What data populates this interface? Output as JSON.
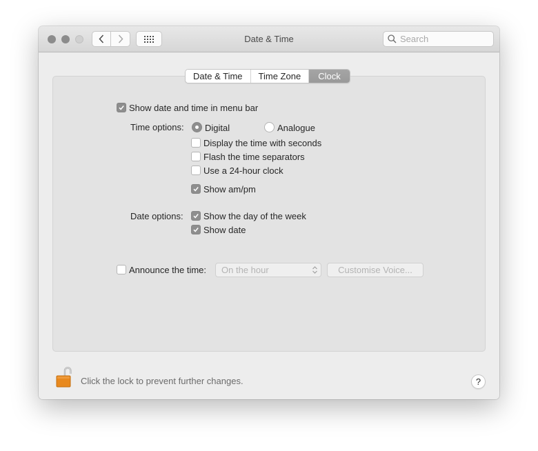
{
  "window": {
    "title": "Date & Time",
    "search_placeholder": "Search",
    "search_value": ""
  },
  "toolbar": {
    "back_icon": "chevron-left-icon",
    "forward_icon": "chevron-right-icon",
    "grid_icon": "show-all-grid-icon"
  },
  "tabs": [
    {
      "label": "Date & Time",
      "active": false
    },
    {
      "label": "Time Zone",
      "active": false
    },
    {
      "label": "Clock",
      "active": true
    }
  ],
  "clock": {
    "show_in_menu_bar": {
      "label": "Show date and time in menu bar",
      "checked": true
    },
    "time_options_label": "Time options:",
    "style_radios": [
      {
        "label": "Digital",
        "selected": true
      },
      {
        "label": "Analogue",
        "selected": false
      }
    ],
    "time_checkboxes": [
      {
        "label": "Display the time with seconds",
        "checked": false
      },
      {
        "label": "Flash the time separators",
        "checked": false
      },
      {
        "label": "Use a 24-hour clock",
        "checked": false
      },
      {
        "label": "Show am/pm",
        "checked": true
      }
    ],
    "date_options_label": "Date options:",
    "date_checkboxes": [
      {
        "label": "Show the day of the week",
        "checked": true
      },
      {
        "label": "Show date",
        "checked": true
      }
    ],
    "announce": {
      "label": "Announce the time:",
      "checked": false,
      "interval_value": "On the hour",
      "customise_voice_label": "Customise Voice..."
    }
  },
  "footer": {
    "lock_text": "Click the lock to prevent further changes.",
    "lock_state": "unlocked",
    "help_label": "?"
  },
  "colors": {
    "active_tab": "#9f9f9f",
    "checkbox_checked": "#8e8e8e",
    "lock": "#e8891e"
  }
}
